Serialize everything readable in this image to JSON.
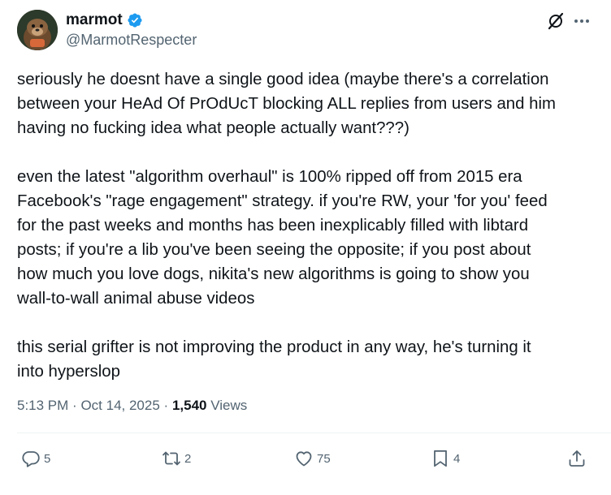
{
  "author": {
    "display_name": "marmot",
    "handle": "@MarmotRespecter",
    "verified": true,
    "avatar_icon": "marmot-avatar"
  },
  "tweet": {
    "paragraphs": [
      [
        "seriously he doesnt have a single good idea (maybe there's a correlation",
        "between your HeAd Of PrOdUcT blocking ALL replies from users and him",
        "having no fucking idea what people actually want???)"
      ],
      [
        "even the latest \"algorithm overhaul\" is 100% ripped off from 2015 era",
        "Facebook's \"rage engagement\" strategy. if you're RW, your 'for you' feed",
        "for the past weeks and months has been inexplicably filled with libtard",
        "posts; if you're a lib you've been seeing the opposite; if you post about",
        "how much you love dogs, nikita's new algorithms is going to show you",
        "wall-to-wall animal abuse videos"
      ],
      [
        "this serial grifter is not improving the product in any way, he's turning it",
        "into hyperslop"
      ]
    ],
    "time": "5:13 PM",
    "date": "Oct 14, 2025",
    "separator": "·",
    "views_count": "1,540",
    "views_label": "Views"
  },
  "actions": {
    "replies": "5",
    "reposts": "2",
    "likes": "75",
    "bookmarks": "4"
  },
  "colors": {
    "text": "#0f1419",
    "secondary": "#536471",
    "verified": "#1d9bf0",
    "divider": "#eff3f4"
  }
}
